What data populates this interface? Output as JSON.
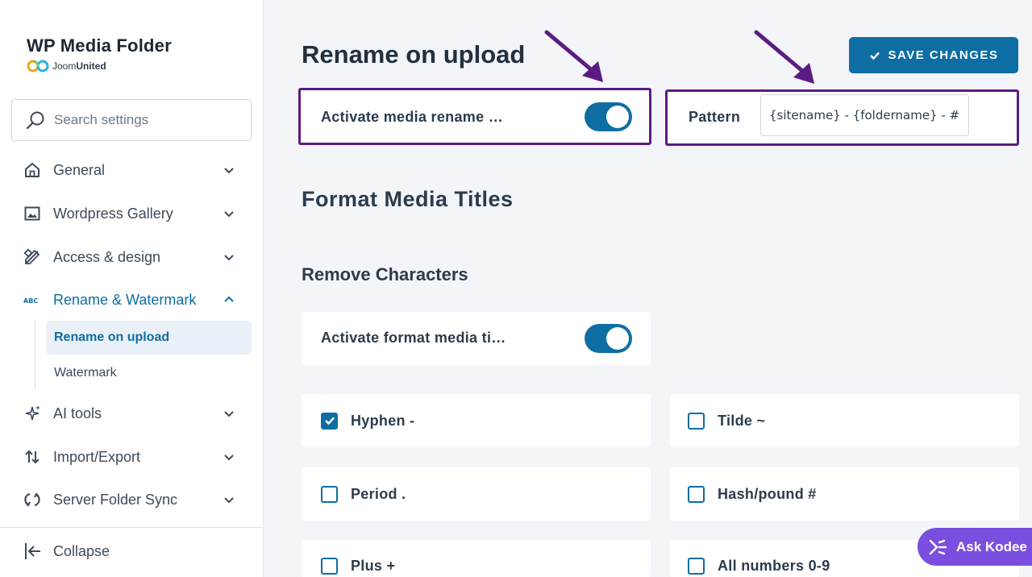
{
  "sidebar": {
    "brand_title": "WP Media Folder",
    "brand_sub_light": "Joom",
    "brand_sub_bold": "United",
    "search_placeholder": "Search settings",
    "items": [
      {
        "label": "General",
        "icon": "home-icon"
      },
      {
        "label": "Wordpress Gallery",
        "icon": "image-icon"
      },
      {
        "label": "Access & design",
        "icon": "design-tools-icon"
      },
      {
        "label": "Rename & Watermark",
        "icon": "abc-icon",
        "active": true
      },
      {
        "label": "AI tools",
        "icon": "sparkles-icon"
      },
      {
        "label": "Import/Export",
        "icon": "import-export-icon"
      },
      {
        "label": "Server Folder Sync",
        "icon": "sync-icon"
      }
    ],
    "subitems": [
      {
        "label": "Rename on upload",
        "active": true
      },
      {
        "label": "Watermark"
      }
    ],
    "collapse_label": "Collapse"
  },
  "main": {
    "title": "Rename on upload",
    "save_label": "SAVE CHANGES",
    "rename_toggle_label": "Activate media rename …",
    "rename_toggle_on": true,
    "pattern_label": "Pattern",
    "pattern_value": "{sitename} - {foldername} - #",
    "section_title": "Format Media Titles",
    "subsection_title": "Remove Characters",
    "format_toggle_label": "Activate format media ti…",
    "format_toggle_on": true,
    "options": [
      {
        "label": "Hyphen -",
        "checked": true
      },
      {
        "label": "Tilde ~",
        "checked": false
      },
      {
        "label": "Period .",
        "checked": false
      },
      {
        "label": "Hash/pound #",
        "checked": false
      },
      {
        "label": "Plus +",
        "checked": false
      },
      {
        "label": "All numbers 0-9",
        "checked": false
      }
    ]
  },
  "kodee_label": "Ask Kodee",
  "colors": {
    "accent": "#0e6ea3",
    "highlight": "#5a1c82",
    "kodee": "#7a4fe0"
  }
}
